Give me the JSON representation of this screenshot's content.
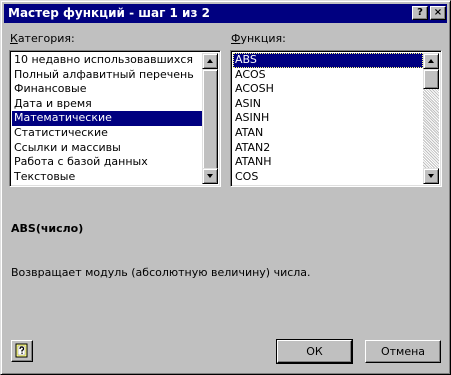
{
  "window": {
    "title": "Мастер функций - шаг 1 из 2"
  },
  "title_buttons": {
    "help": "?",
    "close": "×"
  },
  "category": {
    "label": "Категория:",
    "items": [
      "10 недавно использовавшихся",
      "Полный алфавитный перечень",
      "Финансовые",
      "Дата и время",
      "Математические",
      "Статистические",
      "Ссылки и массивы",
      "Работа с базой данных",
      "Текстовые"
    ],
    "selected": "Математические"
  },
  "function": {
    "label": "Функция:",
    "items": [
      "ABS",
      "ACOS",
      "ACOSH",
      "ASIN",
      "ASINH",
      "ATAN",
      "ATAN2",
      "ATANH",
      "COS"
    ],
    "selected": "ABS"
  },
  "syntax": "ABS(число)",
  "description": "Возвращает модуль (абсолютную величину) числа.",
  "buttons": {
    "ok": "ОК",
    "cancel": "Отмена"
  },
  "icons": {
    "help": "question-book-icon",
    "scroll_up": "scroll-up-arrow-icon",
    "scroll_down": "scroll-down-arrow-icon"
  },
  "colors": {
    "titlebar": "#000080",
    "selection": "#000080",
    "face": "#c0c0c0"
  }
}
